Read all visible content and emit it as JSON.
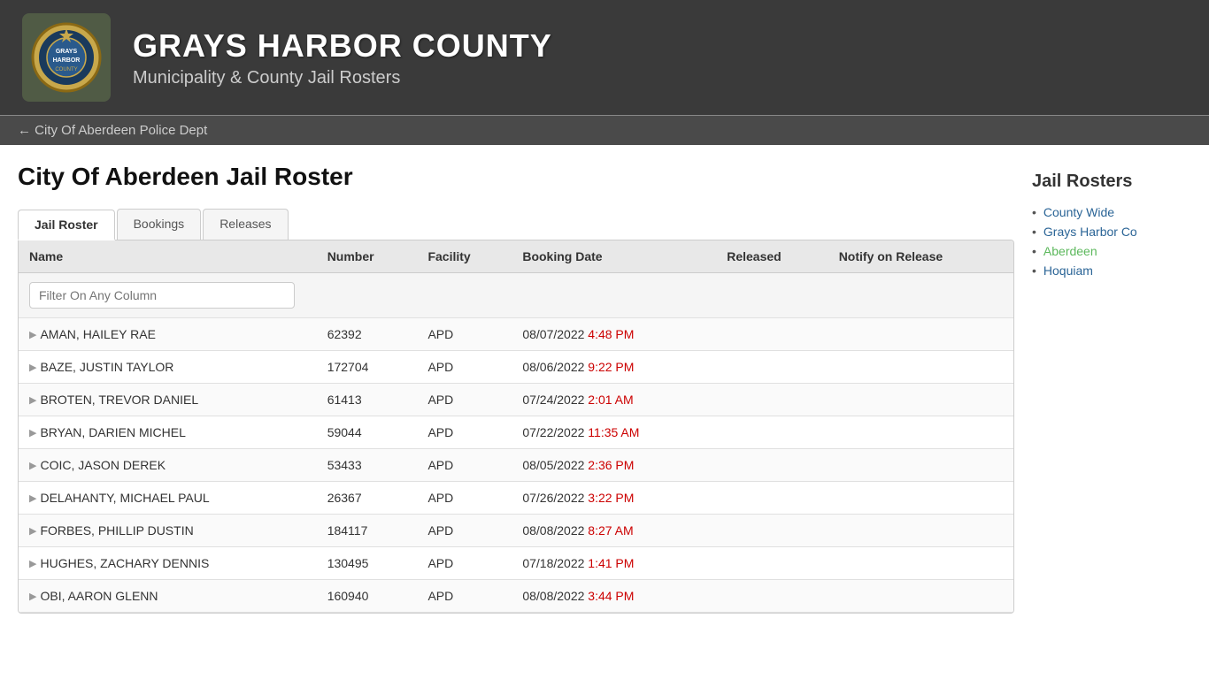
{
  "header": {
    "title": "GRAYS HARBOR COUNTY",
    "subtitle": "Municipality & County Jail Rosters"
  },
  "nav": {
    "back_label": "← City Of Aberdeen Police Dept"
  },
  "page": {
    "title": "City Of Aberdeen Jail Roster"
  },
  "tabs": [
    {
      "label": "Jail Roster",
      "active": true
    },
    {
      "label": "Bookings",
      "active": false
    },
    {
      "label": "Releases",
      "active": false
    }
  ],
  "table": {
    "columns": [
      "Name",
      "Number",
      "Facility",
      "Booking Date",
      "Released",
      "Notify on Release"
    ],
    "filter_placeholder": "Filter On Any Column",
    "rows": [
      {
        "name": "AMAN, HAILEY RAE",
        "number": "62392",
        "facility": "APD",
        "booking_date": "08/07/2022 4:48 PM",
        "released": "",
        "notify": ""
      },
      {
        "name": "BAZE, JUSTIN TAYLOR",
        "number": "172704",
        "facility": "APD",
        "booking_date": "08/06/2022 9:22 PM",
        "released": "",
        "notify": ""
      },
      {
        "name": "BROTEN, TREVOR DANIEL",
        "number": "61413",
        "facility": "APD",
        "booking_date": "07/24/2022 2:01 AM",
        "released": "",
        "notify": ""
      },
      {
        "name": "BRYAN, DARIEN MICHEL",
        "number": "59044",
        "facility": "APD",
        "booking_date": "07/22/2022 11:35 AM",
        "released": "",
        "notify": ""
      },
      {
        "name": "COIC, JASON DEREK",
        "number": "53433",
        "facility": "APD",
        "booking_date": "08/05/2022 2:36 PM",
        "released": "",
        "notify": ""
      },
      {
        "name": "DELAHANTY, MICHAEL PAUL",
        "number": "26367",
        "facility": "APD",
        "booking_date": "07/26/2022 3:22 PM",
        "released": "",
        "notify": ""
      },
      {
        "name": "FORBES, PHILLIP DUSTIN",
        "number": "184117",
        "facility": "APD",
        "booking_date": "08/08/2022 8:27 AM",
        "released": "",
        "notify": ""
      },
      {
        "name": "HUGHES, ZACHARY DENNIS",
        "number": "130495",
        "facility": "APD",
        "booking_date": "07/18/2022 1:41 PM",
        "released": "",
        "notify": ""
      },
      {
        "name": "OBI, AARON GLENN",
        "number": "160940",
        "facility": "APD",
        "booking_date": "08/08/2022 3:44 PM",
        "released": "",
        "notify": ""
      }
    ]
  },
  "sidebar": {
    "title": "Jail Rosters",
    "links": [
      {
        "label": "County Wide",
        "active": false
      },
      {
        "label": "Grays Harbor Co",
        "active": false
      },
      {
        "label": "Aberdeen",
        "active": true
      },
      {
        "label": "Hoquiam",
        "active": false
      }
    ]
  }
}
